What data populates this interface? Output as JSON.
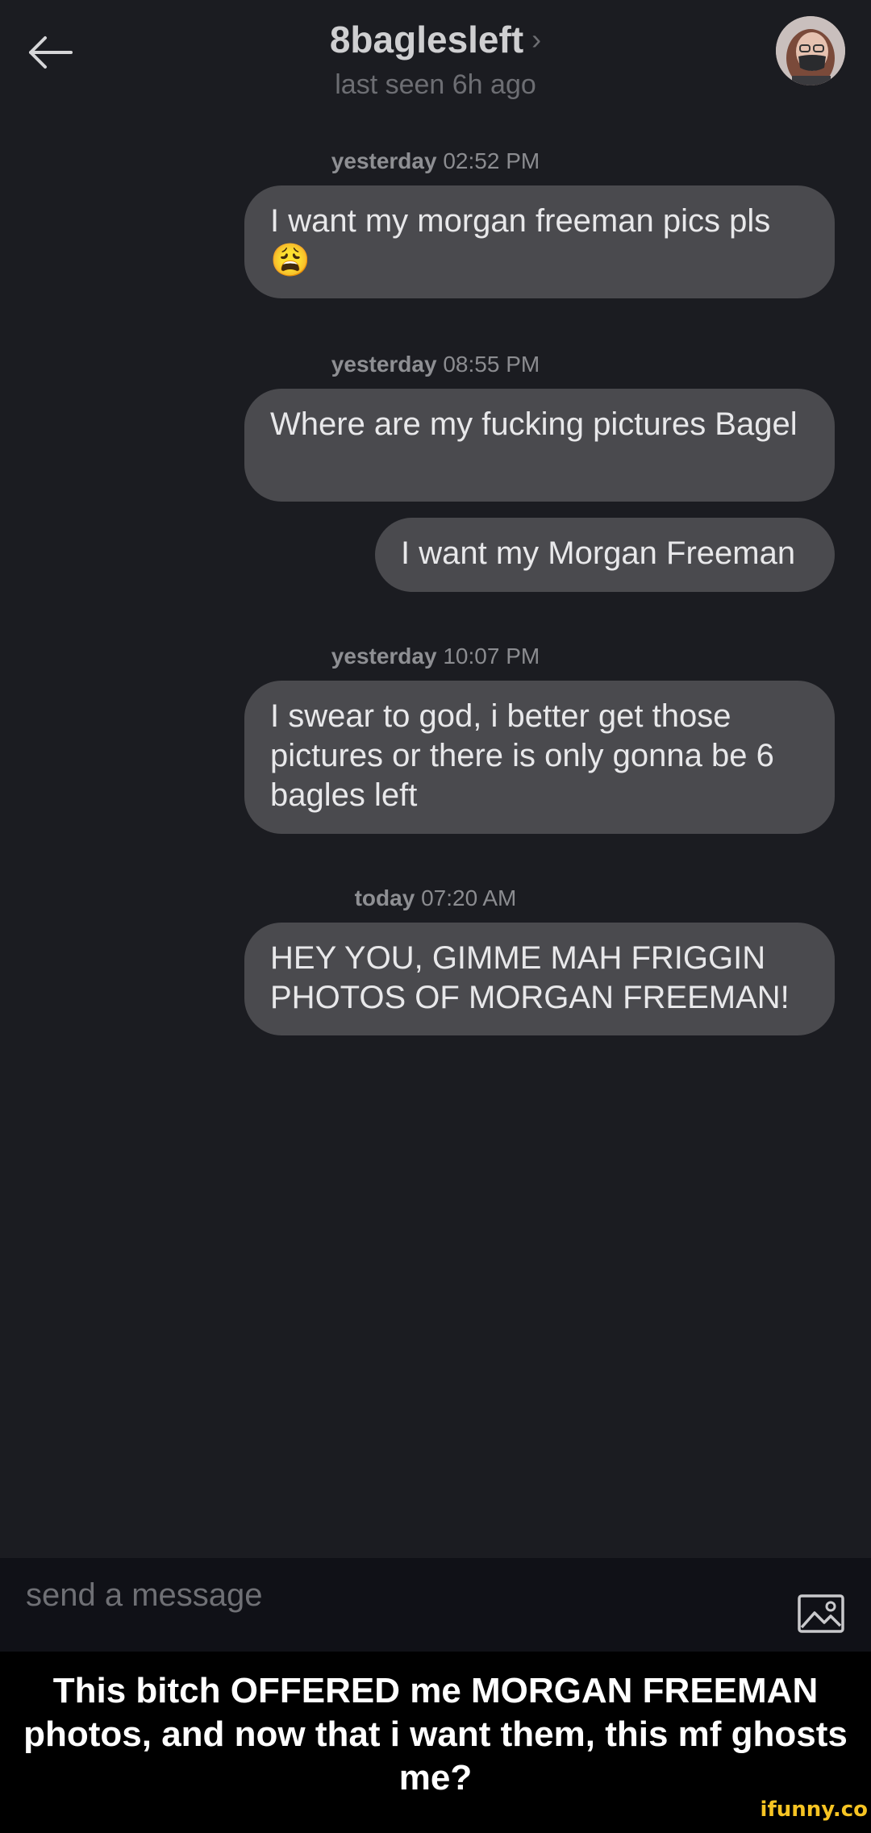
{
  "header": {
    "title": "8baglesleft",
    "chevron": "›",
    "status": "last seen 6h ago",
    "back_icon": "arrow-left-icon",
    "avatar": "contact-avatar"
  },
  "conversation": [
    {
      "day": "yesterday",
      "time": "02:52 PM",
      "messages": [
        "I want my morgan freeman pics pls 😩"
      ]
    },
    {
      "day": "yesterday",
      "time": "08:55 PM",
      "messages": [
        "Where are my fucking pictures Bagel",
        "I want my Morgan Freeman"
      ]
    },
    {
      "day": "yesterday",
      "time": "10:07 PM",
      "messages": [
        "I swear to god, i better get those pictures or there is only gonna be 6 bagles left"
      ]
    },
    {
      "day": "today",
      "time": "07:20 AM",
      "messages": [
        "HEY YOU, GIMME MAH FRIGGIN PHOTOS OF MORGAN FREEMAN!"
      ]
    }
  ],
  "composer": {
    "placeholder": "send a message",
    "attach_icon": "image-icon"
  },
  "caption": "This bitch OFFERED me MORGAN FREEMAN photos, and now that i want them, this mf ghosts me?",
  "watermark": "ifunny.co",
  "colors": {
    "background": "#1b1c21",
    "bubble": "#4a4a4e",
    "composer": "#101117",
    "watermark": "#f6c423"
  }
}
